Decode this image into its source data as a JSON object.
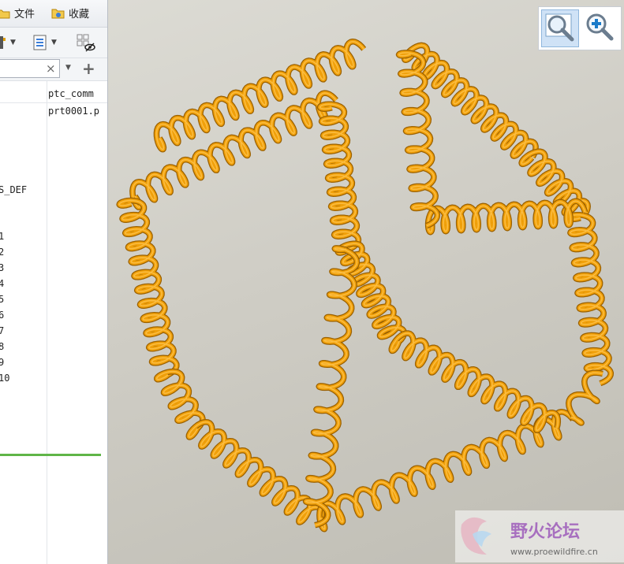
{
  "menu": {
    "items": [
      {
        "label": "文件",
        "icon": "folder-icon"
      },
      {
        "label": "收藏",
        "icon": "favorites-icon"
      }
    ]
  },
  "toolbar": {
    "buttons": [
      {
        "icon": "settings-icon"
      },
      {
        "icon": "list-icon"
      },
      {
        "icon": "hide-columns-icon"
      }
    ]
  },
  "filter": {
    "value": "",
    "clear_label": "×",
    "add_label": "+"
  },
  "tree": {
    "column_header": "ptc_comm",
    "rows": [
      {
        "col1": "",
        "col2": "prt0001.p"
      },
      {
        "col1": "S_DEF",
        "col2": ""
      },
      {
        "col1": "1",
        "col2": ""
      },
      {
        "col1": "2",
        "col2": ""
      },
      {
        "col1": "3",
        "col2": ""
      },
      {
        "col1": "4",
        "col2": ""
      },
      {
        "col1": "5",
        "col2": ""
      },
      {
        "col1": "6",
        "col2": ""
      },
      {
        "col1": "7",
        "col2": ""
      },
      {
        "col1": "8",
        "col2": ""
      },
      {
        "col1": "9",
        "col2": ""
      },
      {
        "col1": "10",
        "col2": ""
      }
    ]
  },
  "viewport": {
    "model_color": "#f0a00a",
    "zoom_buttons": [
      {
        "icon": "zoom-window-icon",
        "active": true
      },
      {
        "icon": "zoom-in-icon",
        "active": false
      }
    ]
  },
  "watermark": {
    "title": "野火论坛",
    "url": "www.proewildfire.cn"
  }
}
